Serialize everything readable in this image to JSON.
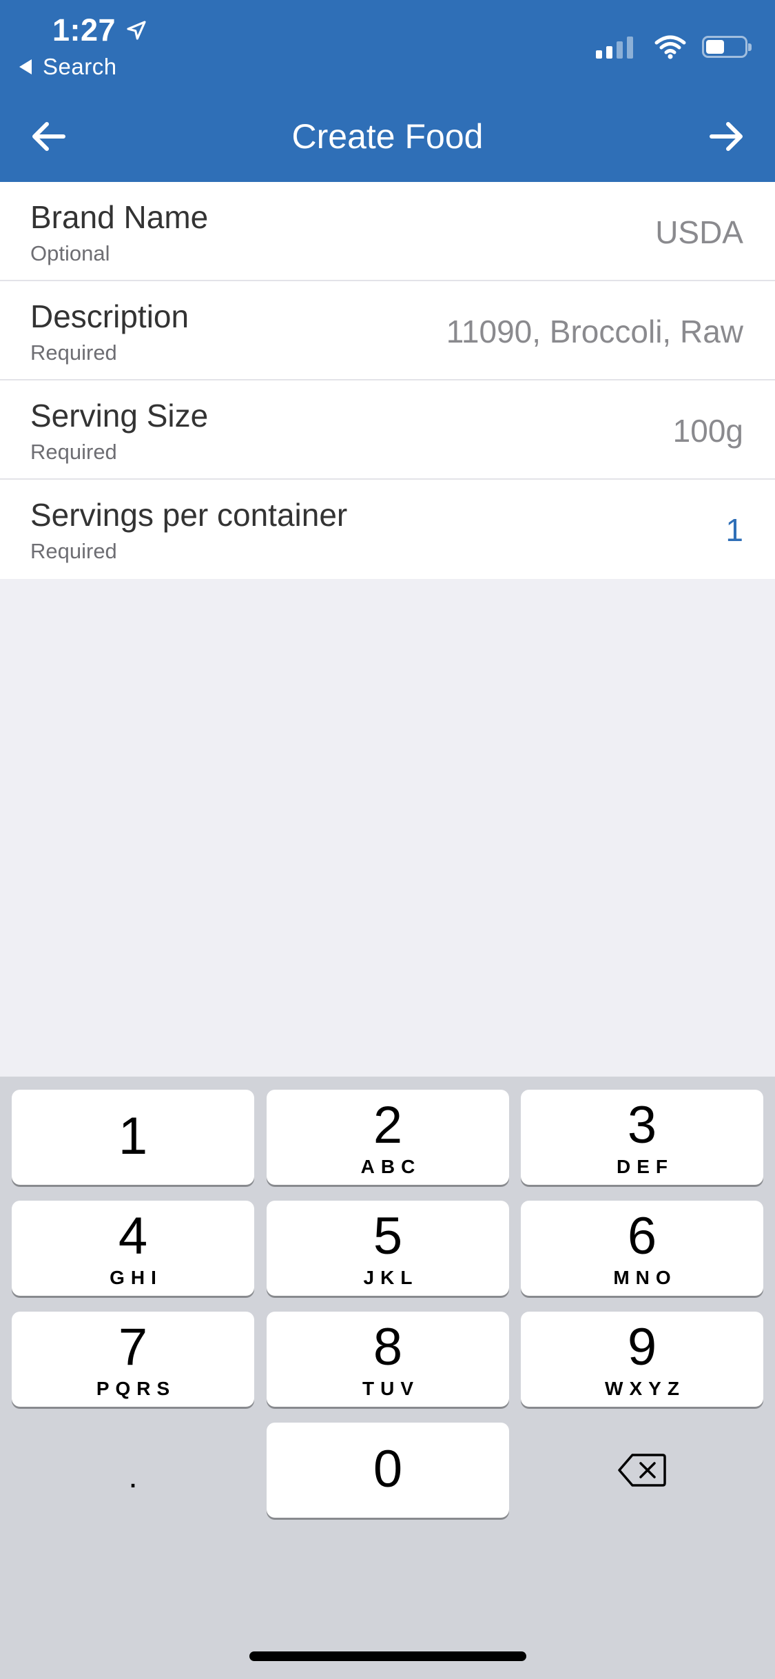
{
  "status_bar": {
    "time": "1:27",
    "back_app_label": "Search"
  },
  "nav": {
    "title": "Create Food",
    "back_icon": "arrow-left-icon",
    "forward_icon": "arrow-right-icon"
  },
  "form": {
    "rows": [
      {
        "label": "Brand Name",
        "sublabel": "Optional",
        "value": "USDA"
      },
      {
        "label": "Description",
        "sublabel": "Required",
        "value": "11090, Broccoli, Raw"
      },
      {
        "label": "Serving Size",
        "sublabel": "Required",
        "value": "100g"
      },
      {
        "label": "Servings per container",
        "sublabel": "Required",
        "value": "1"
      }
    ]
  },
  "keypad": {
    "keys": [
      {
        "digit": "1",
        "letters": ""
      },
      {
        "digit": "2",
        "letters": "ABC"
      },
      {
        "digit": "3",
        "letters": "DEF"
      },
      {
        "digit": "4",
        "letters": "GHI"
      },
      {
        "digit": "5",
        "letters": "JKL"
      },
      {
        "digit": "6",
        "letters": "MNO"
      },
      {
        "digit": "7",
        "letters": "PQRS"
      },
      {
        "digit": "8",
        "letters": "TUV"
      },
      {
        "digit": "9",
        "letters": "WXYZ"
      },
      {
        "digit": "0",
        "letters": ""
      }
    ],
    "decimal": ".",
    "delete_icon": "backspace-icon"
  },
  "colors": {
    "header_bg": "#2F6FB7",
    "accent": "#2F6FB7",
    "page_bg": "#EFEFF4",
    "keypad_bg": "#D1D3D9"
  }
}
